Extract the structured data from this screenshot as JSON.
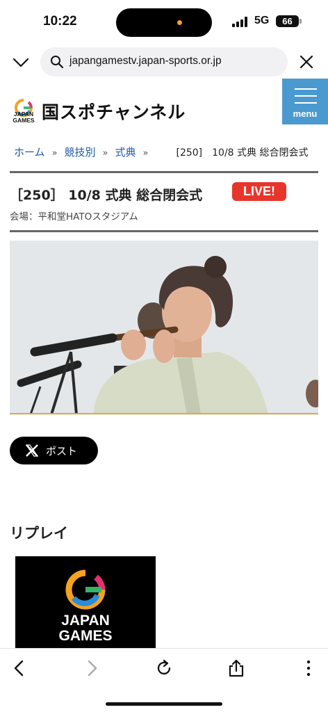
{
  "status_bar": {
    "time": "10:22",
    "network": "5G",
    "battery": "66"
  },
  "browser": {
    "url": "japangamestv.japan-sports.or.jp",
    "icons": [
      "chevron-down-icon",
      "search-icon",
      "close-icon"
    ]
  },
  "site": {
    "logo_text_line1": "JAPAN",
    "logo_text_line2": "GAMES",
    "title": "国スポチャンネル",
    "menu_label": "menu",
    "accent_color": "#4a9ad0"
  },
  "breadcrumb": {
    "items": [
      "ホーム",
      "競技別",
      "式典"
    ],
    "separator": "»",
    "current": "[250]　10/8 式典 総合閉会式"
  },
  "event": {
    "title": "［250］ 10/8 式典 総合閉会式",
    "live_badge": "LIVE!",
    "live_color": "#e8352b",
    "venue": "会場：平和堂HATOスタジアム"
  },
  "share": {
    "post_label": "ポスト"
  },
  "replay": {
    "section_title": "リプレイ",
    "thumb_line1": "JAPAN",
    "thumb_line2": "GAMES"
  },
  "toolbar": {
    "icons": [
      "back-icon",
      "forward-icon",
      "reload-icon",
      "share-icon",
      "more-icon"
    ]
  }
}
